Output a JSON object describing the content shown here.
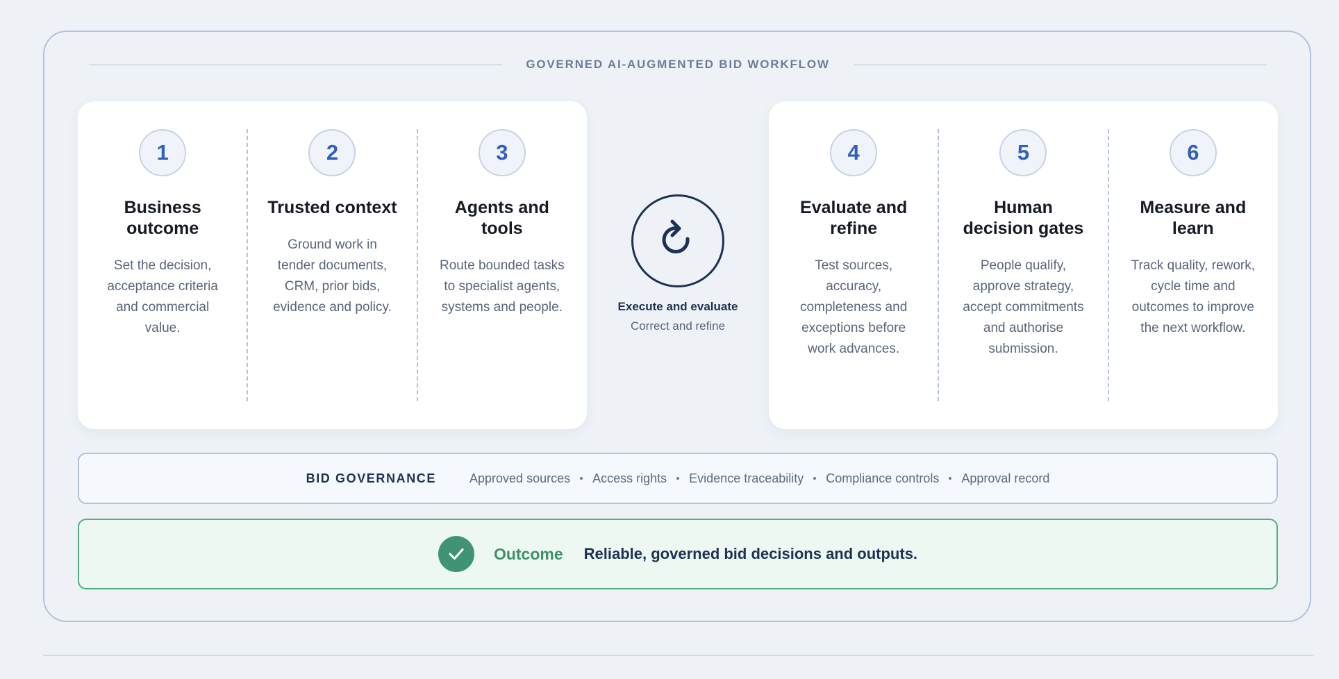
{
  "title": "GOVERNED AI-AUGMENTED BID WORKFLOW",
  "steps_left": [
    {
      "number": "1",
      "title": "Business outcome",
      "description": "Set the decision, acceptance criteria and commercial value."
    },
    {
      "number": "2",
      "title": "Trusted context",
      "description": "Ground work in tender documents, CRM, prior bids, evidence and policy."
    },
    {
      "number": "3",
      "title": "Agents and tools",
      "description": "Route bounded tasks to specialist agents, systems and people."
    }
  ],
  "center": {
    "icon": "refresh-cycle-icon",
    "title": "Execute and evaluate",
    "subtitle": "Correct and refine"
  },
  "steps_right": [
    {
      "number": "4",
      "title": "Evaluate and refine",
      "description": "Test sources, accuracy, completeness and exceptions before work advances."
    },
    {
      "number": "5",
      "title": "Human decision gates",
      "description": "People qualify, approve strategy, accept commitments and authorise submission."
    },
    {
      "number": "6",
      "title": "Measure and learn",
      "description": "Track quality, rework, cycle time and outcomes to improve the next workflow."
    }
  ],
  "governance": {
    "label": "BID GOVERNANCE",
    "items": [
      "Approved sources",
      "Access rights",
      "Evidence traceability",
      "Compliance controls",
      "Approval record"
    ]
  },
  "outcome": {
    "icon": "check-icon",
    "label": "Outcome",
    "text": "Reliable, governed bid decisions and outputs."
  },
  "colors": {
    "accent_blue": "#2f5fbf",
    "navy": "#1e3152",
    "outcome_green": "#419473",
    "background": "#eef2f7"
  }
}
